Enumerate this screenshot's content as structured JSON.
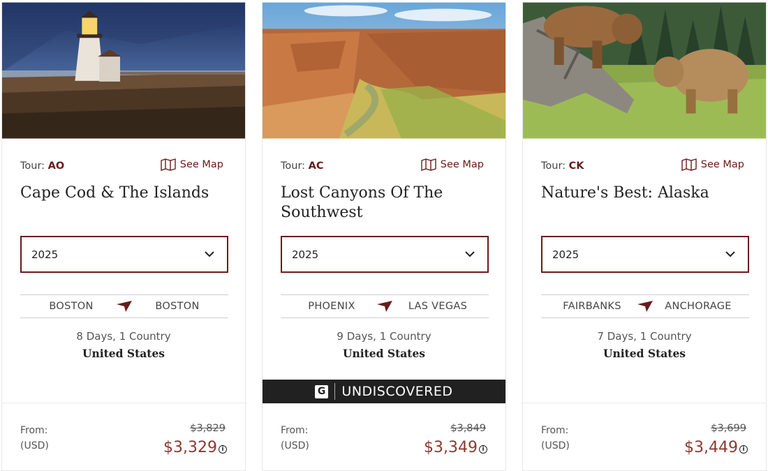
{
  "common": {
    "tour_label": "Tour:",
    "see_map": "See Map",
    "from_label": "From:",
    "currency_label": "(USD)",
    "info_glyph": "i"
  },
  "cards": [
    {
      "code": "AO",
      "title": "Cape Cod & The Islands",
      "year": "2025",
      "start_city": "BOSTON",
      "end_city": "BOSTON",
      "duration": "8 Days, 1 Country",
      "country": "United States",
      "original_price": "$3,829",
      "price": "$3,329"
    },
    {
      "code": "AC",
      "title": "Lost Canyons Of The Southwest",
      "year": "2025",
      "start_city": "PHOENIX",
      "end_city": "LAS VEGAS",
      "duration": "9 Days, 1 Country",
      "country": "United States",
      "badge": {
        "logo": "G",
        "text": "UNDISCOVERED"
      },
      "original_price": "$3,849",
      "price": "$3,349"
    },
    {
      "code": "CK",
      "title": "Nature's Best: Alaska",
      "year": "2025",
      "start_city": "FAIRBANKS",
      "end_city": "ANCHORAGE",
      "duration": "7 Days, 1 Country",
      "country": "United States",
      "original_price": "$3,699",
      "price": "$3,449"
    }
  ],
  "colors": {
    "accent": "#6b1a1a",
    "price": "#8b3a2e",
    "badge_bg": "#212121"
  }
}
